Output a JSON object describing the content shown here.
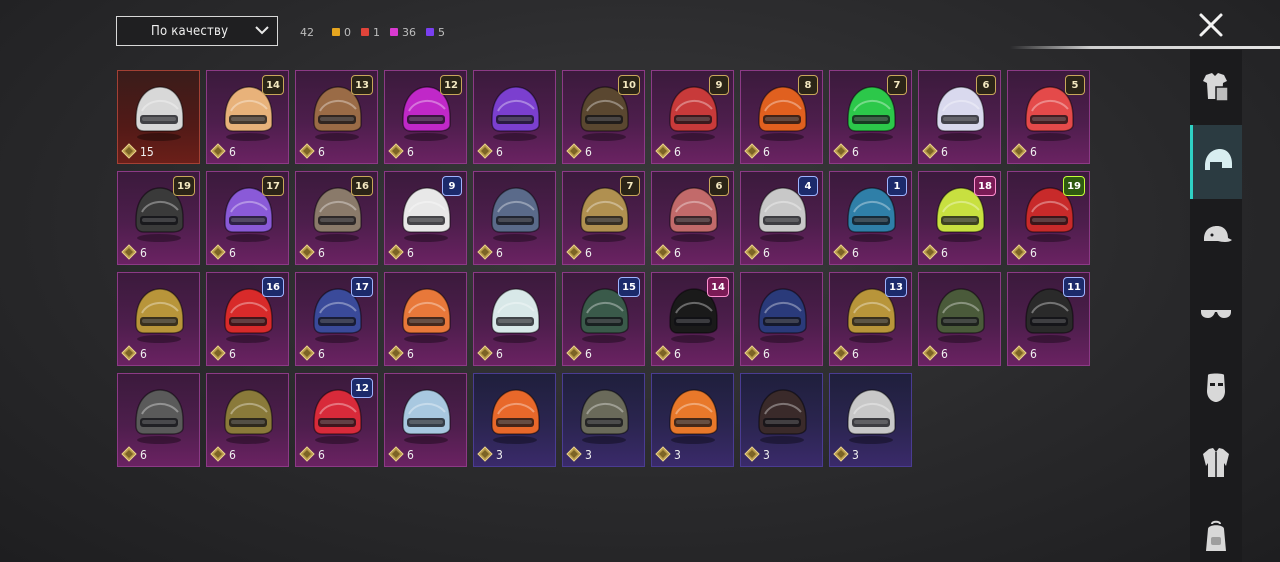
{
  "sort": {
    "label": "По качеству"
  },
  "counts": {
    "total": "42",
    "groups": [
      {
        "color": "#e5a51f",
        "value": "0"
      },
      {
        "color": "#e0443a",
        "value": "1"
      },
      {
        "color": "#d93ad0",
        "value": "36"
      },
      {
        "color": "#7a3ff0",
        "value": "5"
      }
    ]
  },
  "sidebar": {
    "items": [
      {
        "name": "outfit",
        "icon": "outfit-icon",
        "active": false
      },
      {
        "name": "helmet",
        "icon": "helmet-icon",
        "active": true
      },
      {
        "name": "cap",
        "icon": "cap-icon",
        "active": false
      },
      {
        "name": "glasses",
        "icon": "glasses-icon",
        "active": false
      },
      {
        "name": "mask",
        "icon": "mask-icon",
        "active": false
      },
      {
        "name": "jacket",
        "icon": "jacket-icon",
        "active": false
      },
      {
        "name": "backpack",
        "icon": "backpack-icon",
        "active": false
      }
    ]
  },
  "items": [
    {
      "value": "15",
      "level": "",
      "rarity": "gold",
      "color": "#d8d8d8"
    },
    {
      "value": "6",
      "level": "14",
      "rarity": "purple",
      "color": "#e8b27a"
    },
    {
      "value": "6",
      "level": "13",
      "rarity": "purple",
      "color": "#9a6b46"
    },
    {
      "value": "6",
      "level": "12",
      "rarity": "purple",
      "color": "#c028c8"
    },
    {
      "value": "6",
      "level": "",
      "rarity": "purple",
      "color": "#7b3fcf"
    },
    {
      "value": "6",
      "level": "10",
      "rarity": "purple",
      "color": "#5a4730"
    },
    {
      "value": "6",
      "level": "9",
      "rarity": "purple",
      "color": "#c83a3a"
    },
    {
      "value": "6",
      "level": "8",
      "rarity": "purple",
      "color": "#e0601f"
    },
    {
      "value": "6",
      "level": "7",
      "rarity": "purple",
      "color": "#2cc84a"
    },
    {
      "value": "6",
      "level": "6",
      "rarity": "purple",
      "color": "#d9d9ee"
    },
    {
      "value": "6",
      "level": "5",
      "rarity": "purple",
      "color": "#e44a4a"
    },
    {
      "value": "6",
      "level": "19",
      "rarity": "purple",
      "color": "#3a3a3a"
    },
    {
      "value": "6",
      "level": "17",
      "rarity": "purple",
      "color": "#8a5ad8"
    },
    {
      "value": "6",
      "level": "16",
      "rarity": "purple",
      "color": "#8a7a6a"
    },
    {
      "value": "6",
      "level": "9",
      "rarity": "purple",
      "color": "#e8e8e8",
      "levelStyle": "blue"
    },
    {
      "value": "6",
      "level": "",
      "rarity": "purple",
      "color": "#5a6a8a"
    },
    {
      "value": "6",
      "level": "7",
      "rarity": "purple",
      "color": "#b09050"
    },
    {
      "value": "6",
      "level": "6",
      "rarity": "purple",
      "color": "#c26a6a"
    },
    {
      "value": "6",
      "level": "4",
      "rarity": "purple",
      "color": "#c8c8c8",
      "levelStyle": "blue"
    },
    {
      "value": "6",
      "level": "1",
      "rarity": "purple",
      "color": "#2f7fa8",
      "levelStyle": "blue"
    },
    {
      "value": "6",
      "level": "18",
      "rarity": "purple",
      "color": "#c8e040",
      "levelStyle": "pink"
    },
    {
      "value": "6",
      "level": "19",
      "rarity": "purple",
      "color": "#c82a2a",
      "levelStyle": "green"
    },
    {
      "value": "6",
      "level": "",
      "rarity": "purple",
      "color": "#b8953a"
    },
    {
      "value": "6",
      "level": "16",
      "rarity": "purple",
      "color": "#d82a2a",
      "levelStyle": "blue"
    },
    {
      "value": "6",
      "level": "17",
      "rarity": "purple",
      "color": "#3a4a9a",
      "levelStyle": "blue"
    },
    {
      "value": "6",
      "level": "",
      "rarity": "purple",
      "color": "#e8783a"
    },
    {
      "value": "6",
      "level": "",
      "rarity": "purple",
      "color": "#d8e8e8"
    },
    {
      "value": "6",
      "level": "15",
      "rarity": "purple",
      "color": "#3a5a4a",
      "levelStyle": "blue"
    },
    {
      "value": "6",
      "level": "14",
      "rarity": "purple",
      "color": "#1a1a1a",
      "levelStyle": "pink"
    },
    {
      "value": "6",
      "level": "",
      "rarity": "purple",
      "color": "#2a3a7a"
    },
    {
      "value": "6",
      "level": "13",
      "rarity": "purple",
      "color": "#b8953a",
      "levelStyle": "blue"
    },
    {
      "value": "6",
      "level": "",
      "rarity": "purple",
      "color": "#4a5a3a"
    },
    {
      "value": "6",
      "level": "11",
      "rarity": "purple",
      "color": "#2a2a2a",
      "levelStyle": "blue"
    },
    {
      "value": "6",
      "level": "",
      "rarity": "purple",
      "color": "#5a5a5a"
    },
    {
      "value": "6",
      "level": "",
      "rarity": "purple",
      "color": "#8a7a3a"
    },
    {
      "value": "6",
      "level": "12",
      "rarity": "purple",
      "color": "#d82a3a",
      "levelStyle": "blue"
    },
    {
      "value": "6",
      "level": "",
      "rarity": "purple",
      "color": "#a8c8e0"
    },
    {
      "value": "3",
      "level": "",
      "rarity": "blue",
      "color": "#e8682a"
    },
    {
      "value": "3",
      "level": "",
      "rarity": "blue",
      "color": "#6a6a5a"
    },
    {
      "value": "3",
      "level": "",
      "rarity": "blue",
      "color": "#e8782a"
    },
    {
      "value": "3",
      "level": "",
      "rarity": "blue",
      "color": "#3a2a2a"
    },
    {
      "value": "3",
      "level": "",
      "rarity": "blue",
      "color": "#c8c8c8"
    }
  ]
}
